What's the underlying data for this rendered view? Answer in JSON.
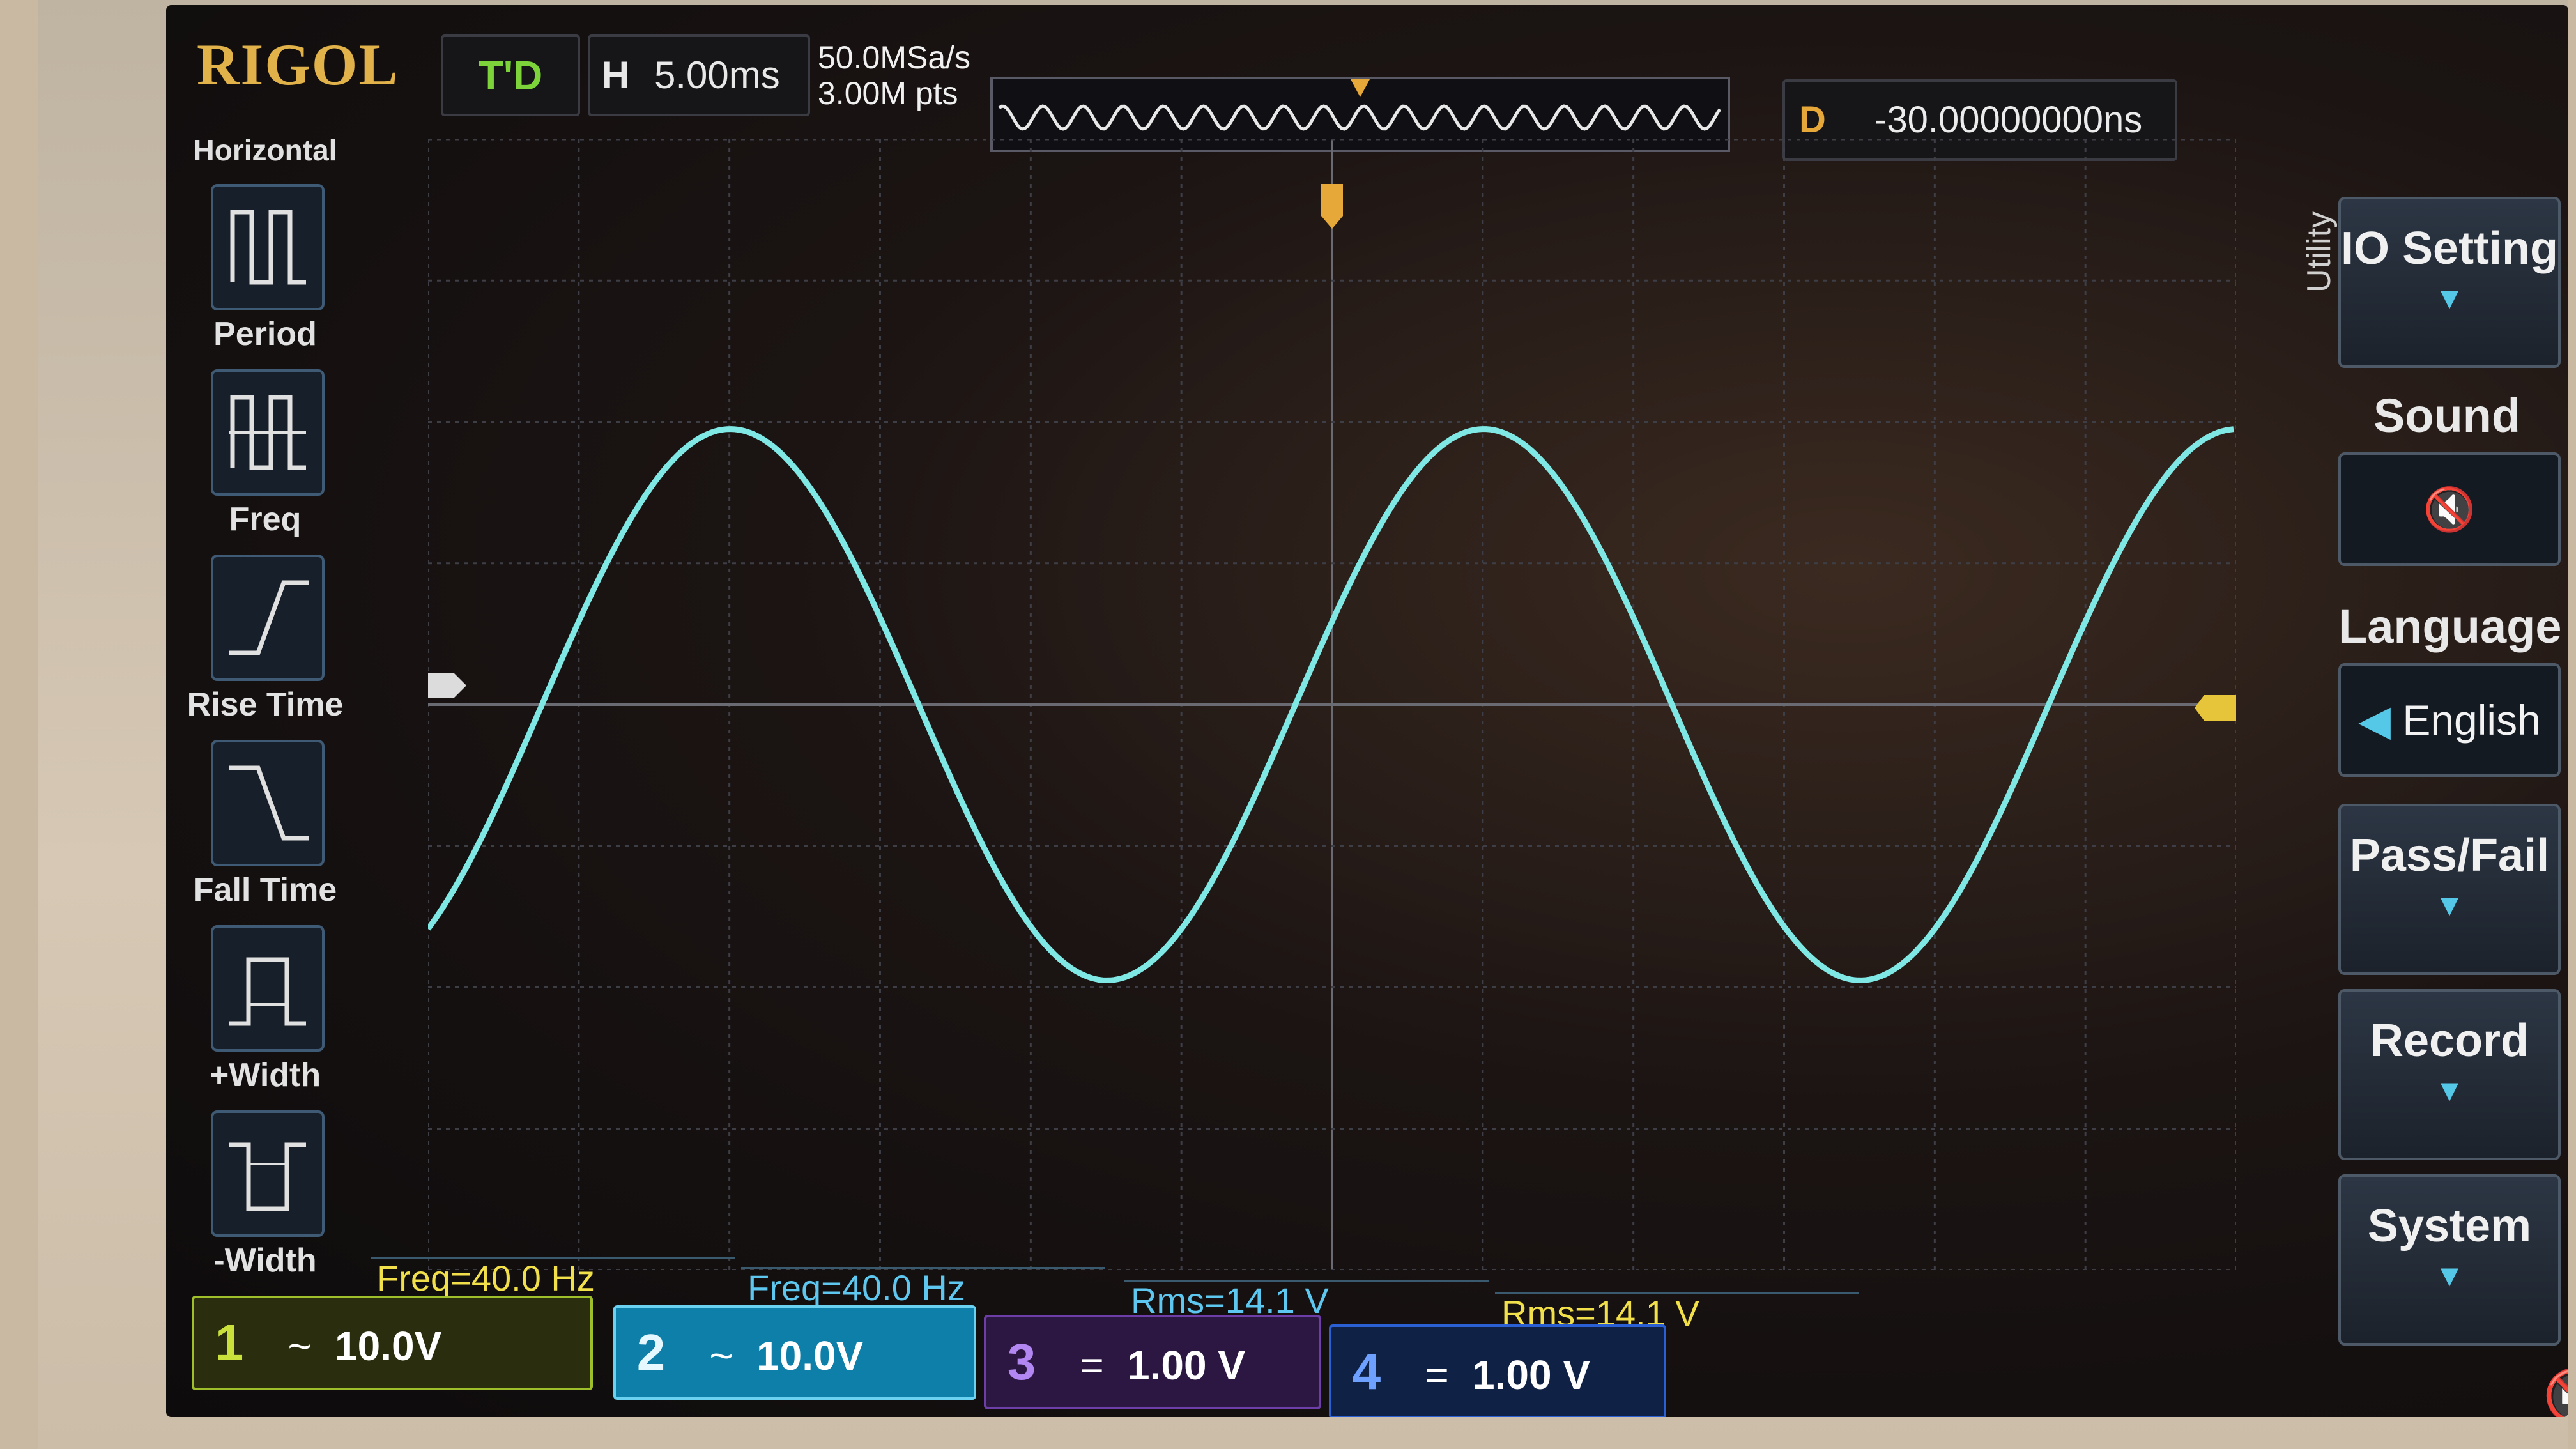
{
  "brand": "RIGOL",
  "trigger_status": "T'D",
  "horizontal": {
    "label": "H",
    "timebase": "5.00ms"
  },
  "sample_rate": "50.0MSa/s",
  "memory_depth": "3.00M pts",
  "trigger_offset": {
    "label": "D",
    "value": "-30.00000000ns"
  },
  "left_menu": {
    "title": "Horizontal",
    "items": [
      {
        "label": "Period",
        "icon": "period-icon"
      },
      {
        "label": "Freq",
        "icon": "frequency-icon"
      },
      {
        "label": "Rise Time",
        "icon": "rise-time-icon"
      },
      {
        "label": "Fall Time",
        "icon": "fall-time-icon"
      },
      {
        "label": "+Width",
        "icon": "positive-width-icon"
      },
      {
        "label": "-Width",
        "icon": "negative-width-icon"
      }
    ]
  },
  "right_menu": {
    "side_label": "Utility",
    "io_setting": "IO Setting",
    "sound_label": "Sound",
    "sound_icon": "speaker-mute-icon",
    "language_label": "Language",
    "language_value": "English",
    "pass_fail": "Pass/Fail",
    "record": "Record",
    "system": "System"
  },
  "measurements": [
    {
      "text": "Freq=40.0 Hz",
      "color": "#f2e04a"
    },
    {
      "text": "Freq=40.0 Hz",
      "color": "#5ec7ef"
    },
    {
      "text": "Rms=14.1 V",
      "color": "#5ec7ef"
    },
    {
      "text": "Rms=14.1 V",
      "color": "#f2e04a"
    }
  ],
  "channels": [
    {
      "num": "1",
      "coupling": "~",
      "scale": "10.0V",
      "color": "#c9e13a"
    },
    {
      "num": "2",
      "coupling": "~",
      "scale": "10.0V",
      "color": "#6ad2f0"
    },
    {
      "num": "3",
      "coupling": "=",
      "scale": "1.00 V",
      "color": "#b387f2"
    },
    {
      "num": "4",
      "coupling": "=",
      "scale": "1.00 V",
      "color": "#6ea0ff"
    }
  ],
  "waveform_color": "#7fe8e4",
  "accent_trigger": "#e7a83a"
}
